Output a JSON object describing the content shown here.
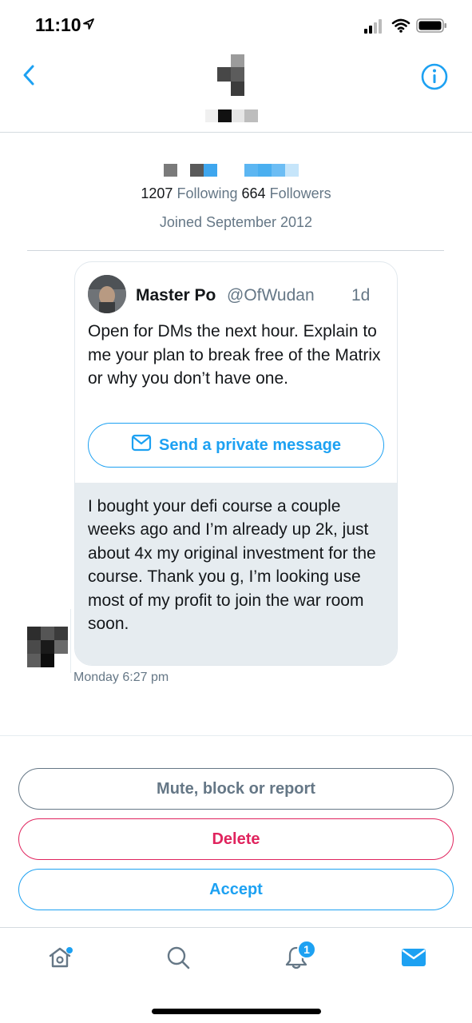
{
  "status_bar": {
    "time": "11:10",
    "icons": [
      "location-arrow-icon",
      "cellular-signal-icon",
      "wifi-icon",
      "battery-icon"
    ]
  },
  "header": {
    "back_icon": "chevron-left-icon",
    "info_icon": "info-circle-icon",
    "title_redacted": true
  },
  "profile": {
    "following_count": "1207",
    "following_label": "Following",
    "followers_count": "664",
    "followers_label": "Followers",
    "joined": "Joined September 2012"
  },
  "message": {
    "tweet": {
      "name": "Master Po",
      "handle": "@OfWudan",
      "time": "1d",
      "text": "Open for DMs the next hour. Explain to me your plan to break free of the Matrix or why you don’t have one.",
      "dm_button_label": "Send a private message",
      "dm_icon": "envelope-icon"
    },
    "reply_text": "I bought your defi course a couple weeks ago and I’m already up 2k, just about 4x my original investment for the course. Thank you g, I’m looking use most of my profit to join the war room soon.",
    "timestamp": "Monday 6:27 pm"
  },
  "actions": {
    "mute_label": "Mute, block or report",
    "delete_label": "Delete",
    "accept_label": "Accept"
  },
  "tab_bar": {
    "notification_count": "1",
    "tabs": [
      "home-icon",
      "search-icon",
      "bell-icon",
      "mail-icon"
    ]
  },
  "colors": {
    "accent": "#1da1f2",
    "danger": "#e0245e",
    "secondary_text": "#657786",
    "bubble_bg": "#e6ecf0"
  }
}
